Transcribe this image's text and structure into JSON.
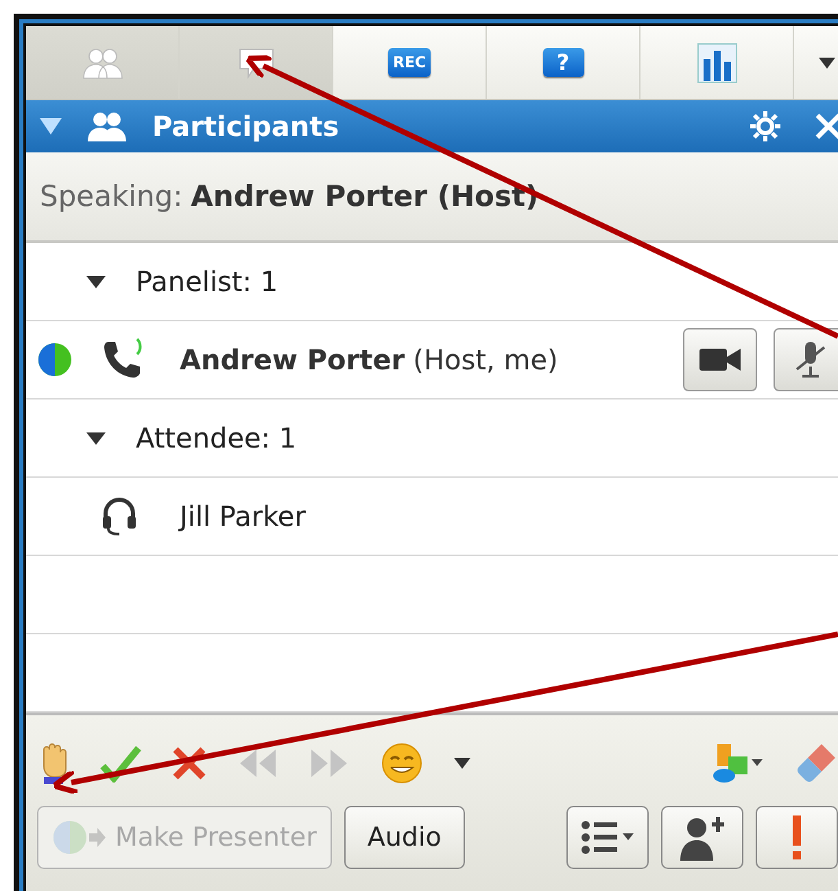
{
  "tabs": [
    {
      "kind": "participants",
      "selected": true
    },
    {
      "kind": "chat",
      "selected": true
    },
    {
      "kind": "record",
      "label": "REC",
      "selected": false
    },
    {
      "kind": "help",
      "label": "?",
      "selected": false
    },
    {
      "kind": "poll",
      "selected": false
    },
    {
      "kind": "more",
      "selected": false
    }
  ],
  "panel": {
    "title": "Participants",
    "expanded": true
  },
  "speaking": {
    "label": "Speaking:",
    "name": "Andrew Porter (Host)"
  },
  "groups": [
    {
      "label": "Panelist: 1",
      "expanded": true,
      "members": [
        {
          "kind": "phone",
          "name": "Andrew Porter",
          "note": "(Host, me)",
          "presenter": true,
          "video": true,
          "muted": true
        }
      ]
    },
    {
      "label": "Attendee: 1",
      "expanded": true,
      "members": [
        {
          "kind": "headset",
          "name": "Jill Parker",
          "presenter": false,
          "video": false,
          "muted": false
        }
      ]
    }
  ],
  "toolbar": [
    {
      "kind": "hand"
    },
    {
      "kind": "check"
    },
    {
      "kind": "cross"
    },
    {
      "kind": "slower",
      "disabled": true
    },
    {
      "kind": "faster",
      "disabled": true
    },
    {
      "kind": "emoji"
    },
    {
      "kind": "caret"
    },
    {
      "kind": "spacer"
    },
    {
      "kind": "shapes"
    },
    {
      "kind": "eraser"
    }
  ],
  "buttons": [
    {
      "kind": "presenter",
      "label": "Make Presenter",
      "disabled": true
    },
    {
      "kind": "text",
      "label": "Audio"
    },
    {
      "kind": "spacer"
    },
    {
      "kind": "list"
    },
    {
      "kind": "invite"
    },
    {
      "kind": "alert"
    }
  ],
  "annotations": [
    {
      "kind": "arrow"
    },
    {
      "kind": "arrow"
    }
  ]
}
